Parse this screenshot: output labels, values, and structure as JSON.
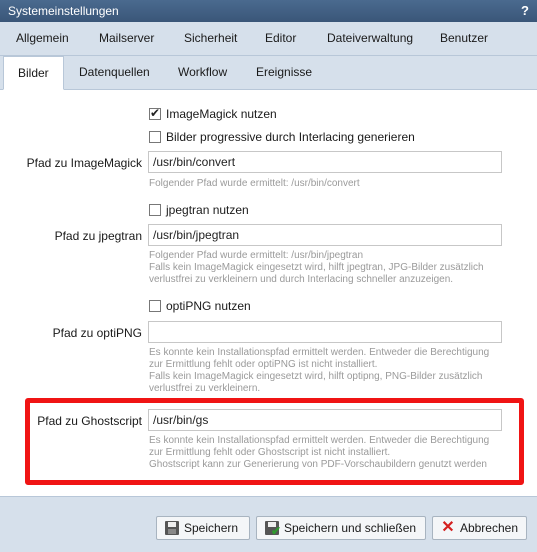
{
  "window": {
    "title": "Systemeinstellungen",
    "help": "?"
  },
  "tabs_row1": [
    "Allgemein",
    "Mailserver",
    "Sicherheit",
    "Editor",
    "Dateiverwaltung",
    "Benutzer"
  ],
  "tabs_row2": [
    "Bilder",
    "Datenquellen",
    "Workflow",
    "Ereignisse"
  ],
  "active_tab": "Bilder",
  "form": {
    "imagemagick_cb": {
      "label": "ImageMagick nutzen",
      "checked": true
    },
    "progressive_cb": {
      "label": "Bilder progressive durch Interlacing generieren",
      "checked": false
    },
    "imagemagick_path": {
      "label": "Pfad zu ImageMagick",
      "value": "/usr/bin/convert",
      "hint": "Folgender Pfad wurde ermittelt: /usr/bin/convert"
    },
    "jpegtran_cb": {
      "label": "jpegtran nutzen",
      "checked": false
    },
    "jpegtran_path": {
      "label": "Pfad zu jpegtran",
      "value": "/usr/bin/jpegtran",
      "hint1": "Folgender Pfad wurde ermittelt: /usr/bin/jpegtran",
      "hint2": "Falls kein ImageMagick eingesetzt wird, hilft jpegtran, JPG-Bilder zusätzlich",
      "hint3": "verlustfrei zu verkleinern und durch Interlacing schneller anzuzeigen."
    },
    "optipng_cb": {
      "label": "optiPNG nutzen",
      "checked": false
    },
    "optipng_path": {
      "label": "Pfad zu optiPNG",
      "value": "",
      "hint1": "Es konnte kein Installationspfad ermittelt werden. Entweder die Berechtigung",
      "hint2": "zur Ermittlung fehlt oder optiPNG ist nicht installiert.",
      "hint3": "Falls kein ImageMagick eingesetzt wird, hilft optipng, PNG-Bilder zusätzlich",
      "hint4": "verlustfrei zu verkleinern."
    },
    "ghostscript_path": {
      "label": "Pfad zu Ghostscript",
      "value": "/usr/bin/gs",
      "hint1": "Es konnte kein Installationspfad ermittelt werden. Entweder die Berechtigung",
      "hint2": "zur Ermittlung fehlt oder Ghostscript ist nicht installiert.",
      "hint3": "Ghostscript kann zur Generierung von PDF-Vorschaubildern genutzt werden"
    }
  },
  "buttons": {
    "save": "Speichern",
    "save_close": "Speichern und schließen",
    "cancel": "Abbrechen"
  },
  "icons": {
    "save": "save-disk-icon",
    "save_close": "save-check-icon",
    "cancel": "close-x-icon"
  },
  "colors": {
    "titlebar": "#3f5e82",
    "tabbar": "#d6e0eb",
    "highlight": "#f01414"
  }
}
